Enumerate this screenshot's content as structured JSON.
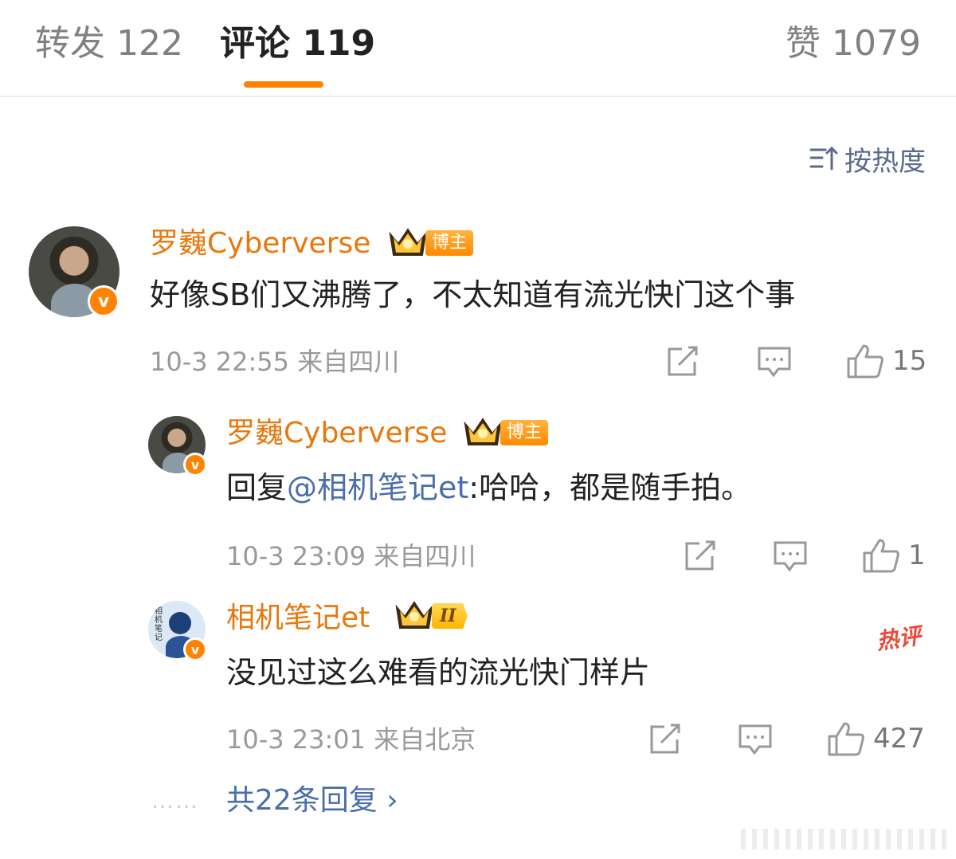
{
  "tabs": {
    "repost": "转发 122",
    "comments": "评论 119",
    "likes": "赞 1079"
  },
  "colors": {
    "accent": "#ff8200",
    "username": "#e8770c",
    "link": "#4a6ea9"
  },
  "sort": {
    "icon": "sort-icon",
    "label": "按热度"
  },
  "comment1": {
    "username": "罗巍Cyberverse",
    "badge": "博主",
    "verified_icon": "v",
    "text": "好像SB们又沸腾了，不太知道有流光快门这个事",
    "time": "10-3 22:55",
    "location": "来自四川",
    "likes": "15"
  },
  "reply1": {
    "username": "罗巍Cyberverse",
    "badge": "博主",
    "verified_icon": "v",
    "prefix": "回复",
    "mention": "@相机笔记et",
    "text": ":哈哈，都是随手拍。",
    "time": "10-3 23:09",
    "location": "来自四川",
    "likes": "1"
  },
  "reply2": {
    "username": "相机笔记et",
    "level": "II",
    "verified_icon": "v",
    "avatar_text": "相机笔记",
    "hot_label": "热评",
    "text": "没见过这么难看的流光快门样片",
    "time": "10-3 23:01",
    "location": "来自北京",
    "likes": "427"
  },
  "more_dots": "……",
  "more_replies": "共22条回复 ›"
}
